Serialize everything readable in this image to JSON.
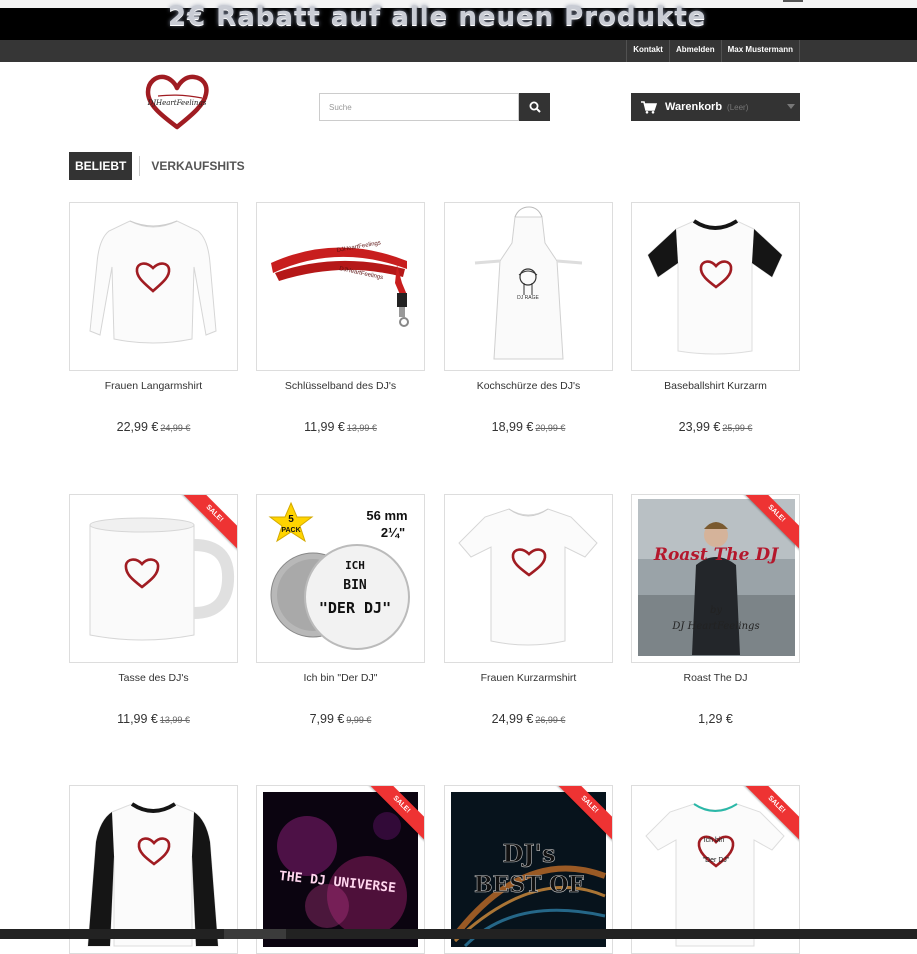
{
  "banner": {
    "text": "2€ Rabatt auf alle neuen Produkte"
  },
  "user_nav": {
    "links": [
      "Kontakt",
      "Abmelden",
      "Max Mustermann"
    ]
  },
  "logo": {
    "text": "DJHeartFeelings"
  },
  "search": {
    "placeholder": "Suche"
  },
  "cart": {
    "label": "Warenkorb",
    "count": "(Leer)"
  },
  "tabs": {
    "active": "BELIEBT",
    "other": "VERKAUFSHITS"
  },
  "sale_label": "SALE!",
  "products": [
    {
      "name": "Frauen Langarmshirt",
      "price": "22,99 €",
      "old_price": "24,99 €",
      "sale": false,
      "image": "longsleeve-white"
    },
    {
      "name": "Schlüsselband des DJ's",
      "price": "11,99 €",
      "old_price": "13,99 €",
      "sale": false,
      "image": "lanyard-red"
    },
    {
      "name": "Kochschürze des DJ's",
      "price": "18,99 €",
      "old_price": "20,99 €",
      "sale": false,
      "image": "apron-white"
    },
    {
      "name": "Baseballshirt Kurzarm",
      "price": "23,99 €",
      "old_price": "25,99 €",
      "sale": false,
      "image": "baseball-tee"
    },
    {
      "name": "Tasse des DJ's",
      "price": "11,99 €",
      "old_price": "13,99 €",
      "sale": true,
      "image": "mug-white"
    },
    {
      "name": "Ich bin \"Der DJ\"",
      "price": "7,99 €",
      "old_price": "9,99 €",
      "sale": false,
      "image": "button-pack",
      "image_text": {
        "pack": "5",
        "pack_word": "PACK",
        "size": "56 mm",
        "inch": "2¼\"",
        "line1": "ICH",
        "line2": "BIN",
        "line3": "\"DER DJ\""
      }
    },
    {
      "name": "Frauen Kurzarmshirt",
      "price": "24,99 €",
      "old_price": "26,99 €",
      "sale": false,
      "image": "tee-women"
    },
    {
      "name": "Roast The DJ",
      "price": "1,29 €",
      "old_price": "",
      "sale": true,
      "image": "album-photo",
      "image_text": {
        "title": "Roast The DJ",
        "by": "by",
        "artist": "DJ HeartFeelings"
      }
    },
    {
      "name": "",
      "price": "",
      "old_price": "",
      "sale": false,
      "image": "baseball-longsleeve"
    },
    {
      "name": "",
      "price": "",
      "old_price": "",
      "sale": true,
      "image": "dj-universe-cover",
      "image_text": {
        "title": "THE DJ UNIVERSE"
      }
    },
    {
      "name": "",
      "price": "",
      "old_price": "",
      "sale": true,
      "image": "best-of-cover",
      "image_text": {
        "line1": "DJ's",
        "line2": "BEST OF"
      }
    },
    {
      "name": "",
      "price": "",
      "old_price": "",
      "sale": true,
      "image": "tee-men",
      "image_text": {
        "line1": "Ich bin",
        "line2": "\"Der DJ\""
      }
    }
  ],
  "colors": {
    "dark": "#333333",
    "nav": "#363636",
    "sale": "#ee3333",
    "heart": "#a01c22"
  }
}
